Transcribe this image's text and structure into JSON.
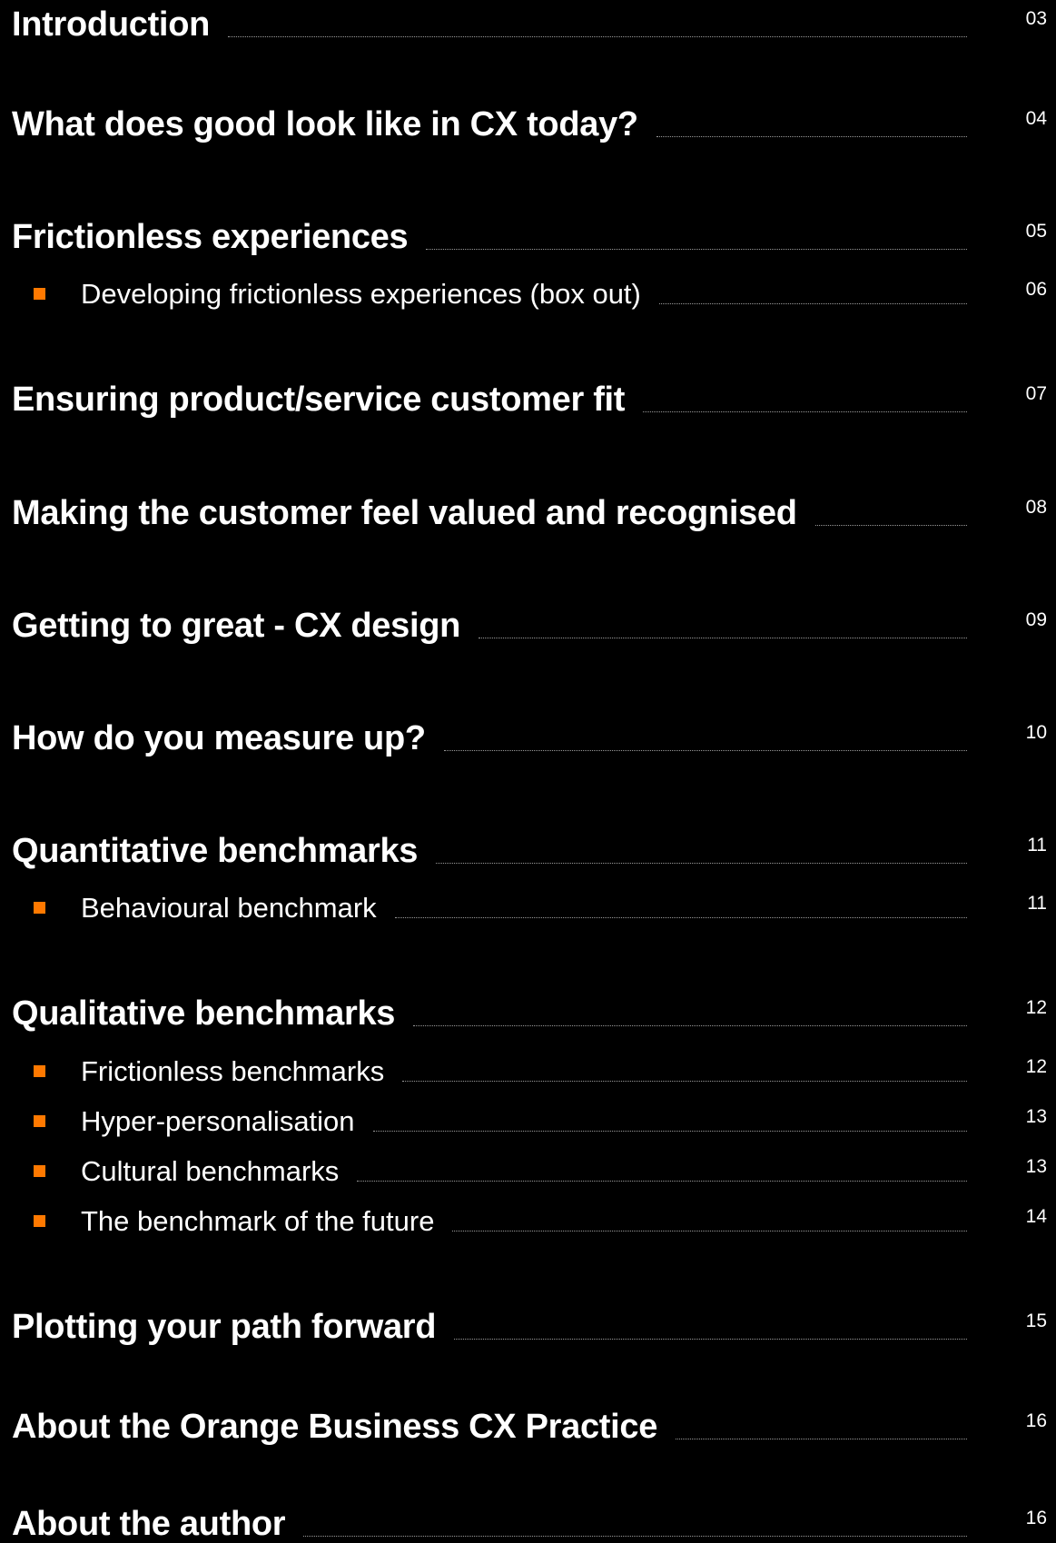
{
  "colors": {
    "background": "#000000",
    "text": "#ffffff",
    "accent_bullet": "#ff7900",
    "leader": "#9a9a9a"
  },
  "toc": [
    {
      "level": "main",
      "title": "Introduction",
      "page": "03"
    },
    {
      "level": "main",
      "title": "What does good look like in CX today?",
      "page": "04"
    },
    {
      "level": "main",
      "title": "Frictionless experiences",
      "page": "05"
    },
    {
      "level": "sub",
      "title": "Developing frictionless experiences (box out)",
      "page": "06"
    },
    {
      "level": "main",
      "title": "Ensuring product/service customer fit",
      "page": "07"
    },
    {
      "level": "main",
      "title": "Making the customer feel valued and recognised",
      "page": "08"
    },
    {
      "level": "main",
      "title": "Getting to great - CX design",
      "page": "09"
    },
    {
      "level": "main",
      "title": "How do you measure up?",
      "page": "10"
    },
    {
      "level": "main",
      "title": "Quantitative benchmarks",
      "page": "11"
    },
    {
      "level": "sub",
      "title": "Behavioural benchmark",
      "page": "11"
    },
    {
      "level": "main",
      "title": "Qualitative benchmarks",
      "page": "12"
    },
    {
      "level": "sub",
      "title": "Frictionless benchmarks",
      "page": "12"
    },
    {
      "level": "sub",
      "title": "Hyper-personalisation",
      "page": "13"
    },
    {
      "level": "sub",
      "title": "Cultural benchmarks",
      "page": "13"
    },
    {
      "level": "sub",
      "title": "The benchmark of the future",
      "page": "14"
    },
    {
      "level": "main",
      "title": "Plotting your path forward",
      "page": "15"
    },
    {
      "level": "main",
      "title": "About the Orange Business CX Practice",
      "page": "16"
    },
    {
      "level": "main",
      "title": "About the author",
      "page": "16"
    }
  ]
}
